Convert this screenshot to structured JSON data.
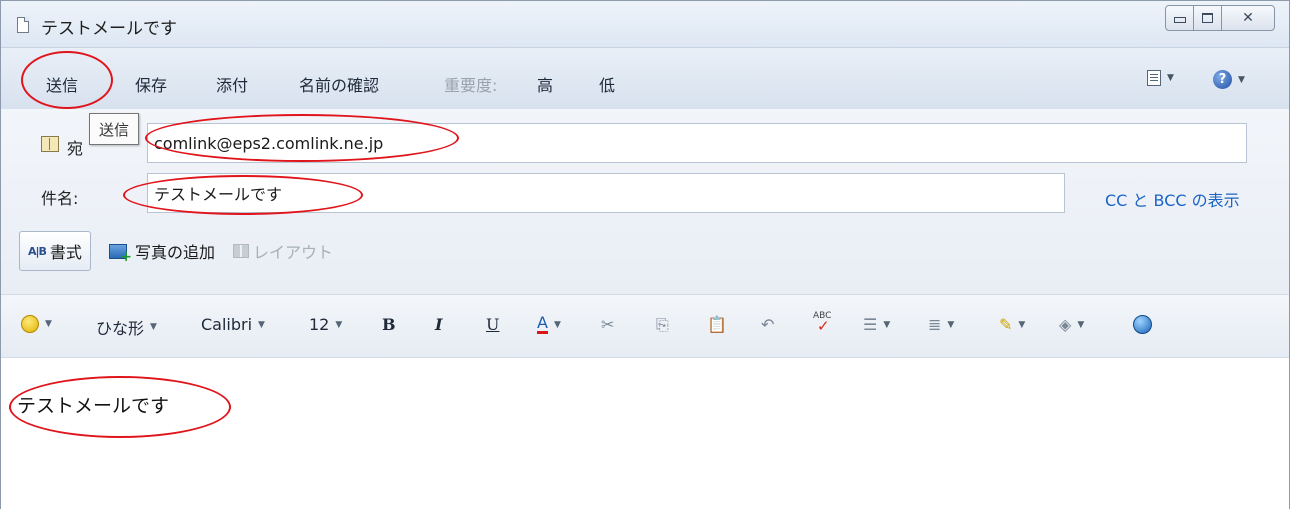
{
  "window": {
    "title": "テストメールです"
  },
  "commands": {
    "send": "送信",
    "save": "保存",
    "attach": "添付",
    "check_names": "名前の確認",
    "importance_label": "重要度:",
    "importance_high": "高",
    "importance_low": "低",
    "help_glyph": "?"
  },
  "tooltip": {
    "text": "送信"
  },
  "fields": {
    "to_label": "宛",
    "to_value": "comlink@eps2.comlink.ne.jp",
    "subject_label": "件名:",
    "subject_value": "テストメールです",
    "cc_bcc_link": "CC と BCC の表示"
  },
  "toolbar2": {
    "format": "書式",
    "add_photo": "写真の追加",
    "layout": "レイアウト"
  },
  "format_toolbar": {
    "stationery": "ひな形",
    "font": "Calibri",
    "size": "12",
    "bold": "B",
    "italic": "I",
    "underline": "U",
    "font_color": "A"
  },
  "body": {
    "text": "テストメールです"
  },
  "icons": {
    "window_controls": [
      "minimize-icon",
      "maximize-icon",
      "close-icon"
    ],
    "annotation_color": "#e0141b",
    "link_color": "#1b64c5"
  }
}
